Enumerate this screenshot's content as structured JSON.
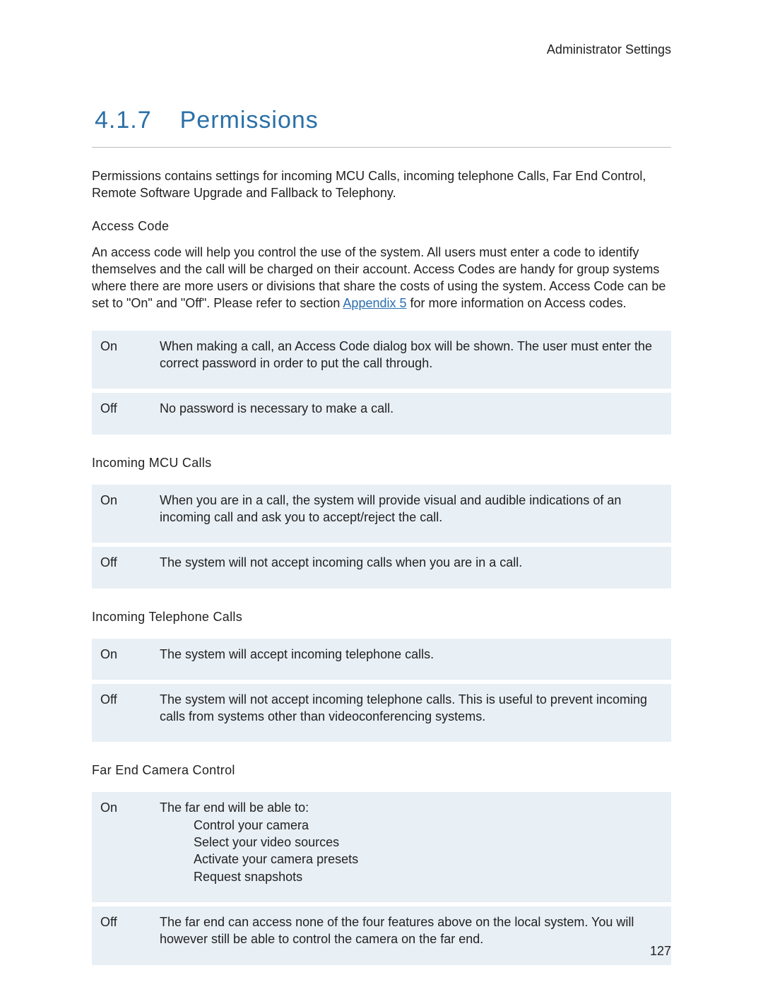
{
  "header": {
    "title": "Administrator Settings"
  },
  "section": {
    "number": "4.1.7",
    "title": "Permissions"
  },
  "intro": "Permissions contains settings for incoming MCU Calls, incoming telephone Calls, Far End Control, Remote Software Upgrade and Fallback to Telephony.",
  "access_code": {
    "heading": "Access Code",
    "desc_before": "An access code will help you control the use of the system. All users must enter a code to identify themselves and the call will be charged on their account. Access Codes are handy for group systems where there are more users or divisions that share the costs of using the system. Access Code can be set to \"On\" and \"Off\". Please refer to section ",
    "link": "Appendix 5",
    "desc_after": " for more information on Access codes.",
    "on": "When making a call, an Access Code dialog box will be shown. The user must enter the correct password in order to put the call through.",
    "off": "No password is necessary to make a call."
  },
  "mcu": {
    "heading": "Incoming MCU Calls",
    "on": "When you are in a call, the system will provide visual and audible indications of an incoming call and ask you to accept/reject the call.",
    "off": "The system will not accept incoming calls when you are in a call."
  },
  "telephone": {
    "heading": "Incoming Telephone Calls",
    "on": "The system will accept incoming telephone calls.",
    "off": "The system will not accept incoming telephone calls. This is useful to prevent incoming calls from systems other than videoconferencing systems."
  },
  "far_end": {
    "heading": "Far End Camera Control",
    "on_intro": "The far end will be able to:",
    "on_items": [
      "Control your camera",
      "Select your video sources",
      "Activate your camera presets",
      "Request snapshots"
    ],
    "off": "The far end can access none of the four features above on the local system. You will however still be able to control the camera on the far end."
  },
  "labels": {
    "on": "On",
    "off": "Off"
  },
  "page_number": "127"
}
